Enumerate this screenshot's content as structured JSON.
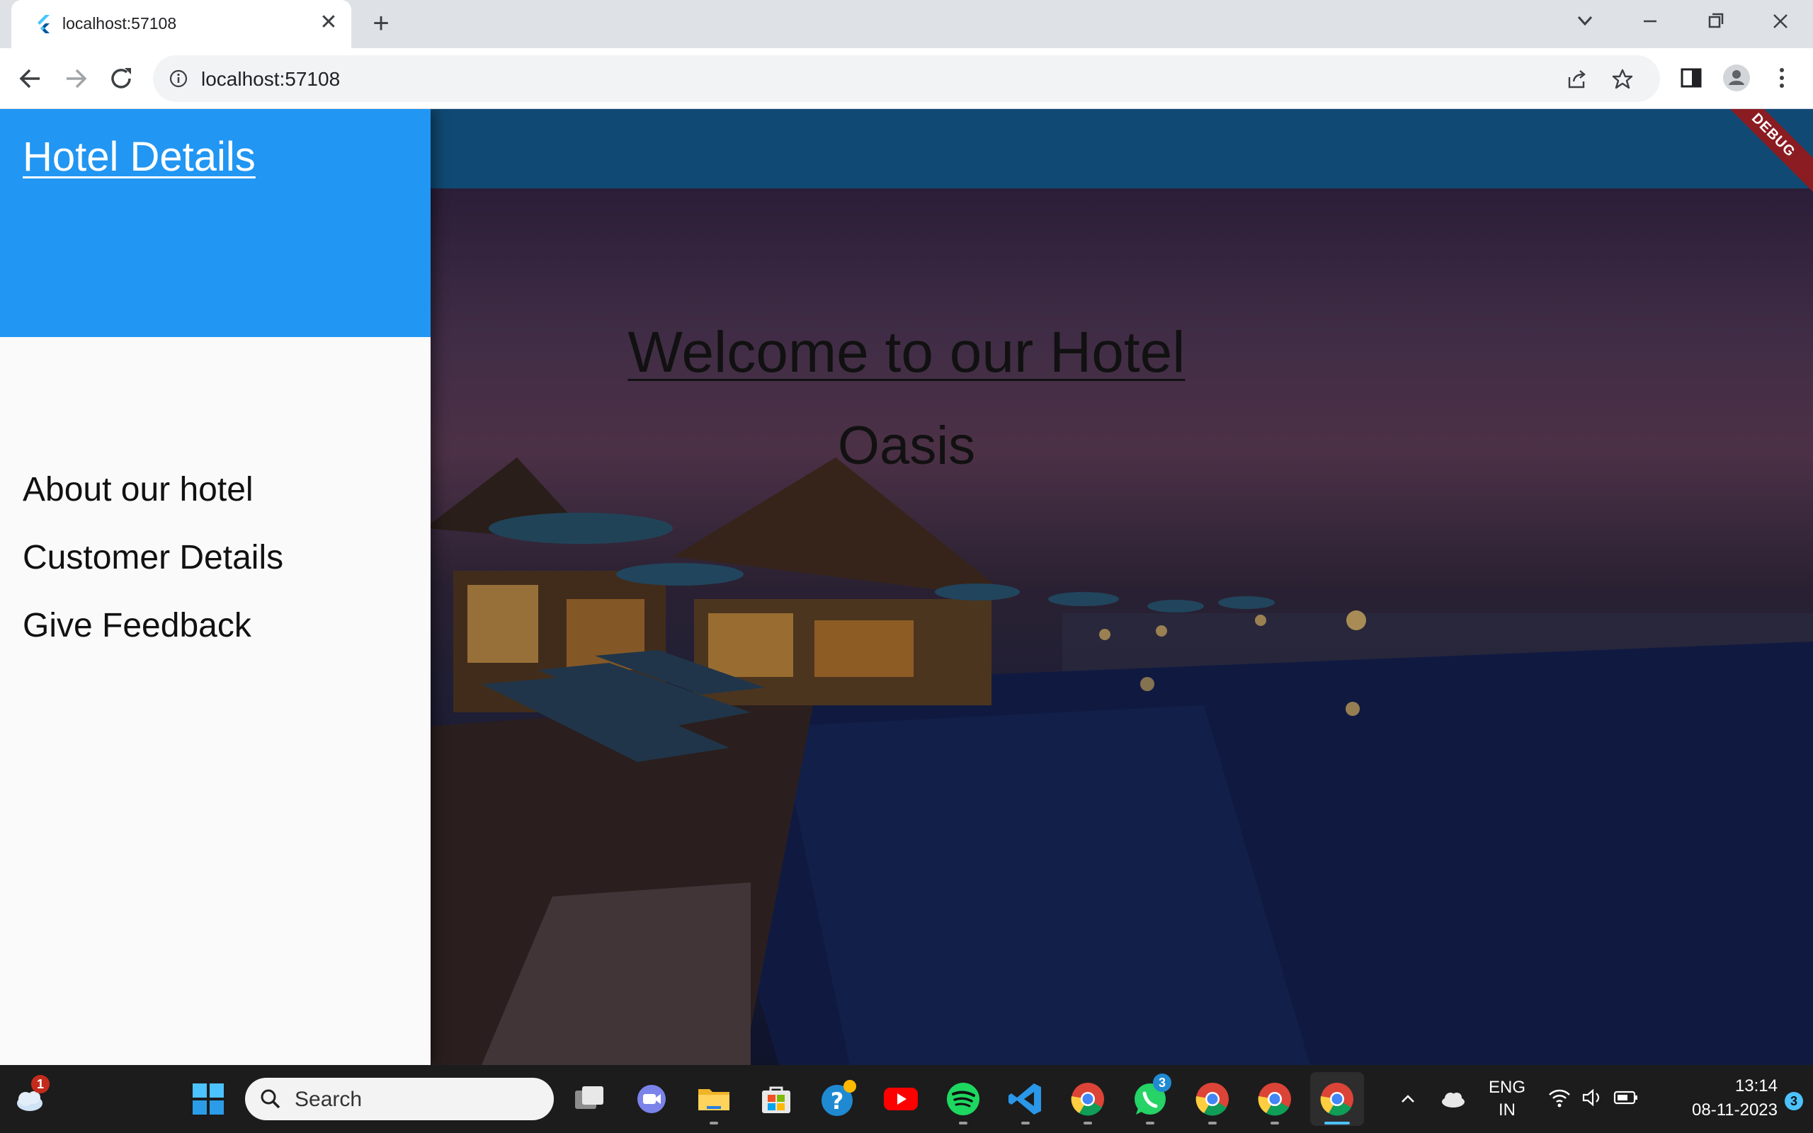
{
  "browser": {
    "tab_title": "localhost:57108",
    "url": "localhost:57108",
    "new_tab_symbol": "+",
    "close_tab_symbol": "✕",
    "window_controls": [
      "chevron-down-icon",
      "minimize-icon",
      "restore-icon",
      "close-icon"
    ]
  },
  "app": {
    "drawer": {
      "title": "Hotel Details",
      "items": [
        "About our hotel",
        "Customer Details",
        "Give Feedback"
      ]
    },
    "hero": {
      "heading": "Welcome to our Hotel",
      "subheading": "Oasis"
    },
    "debug_banner": "DEBUG",
    "colors": {
      "drawer_header": "#2196f3",
      "appbar": "#104a74"
    }
  },
  "taskbar": {
    "search_placeholder": "Search",
    "weather_badge": "1",
    "whatsapp_badge": "3",
    "language_line1": "ENG",
    "language_line2": "IN",
    "time": "13:14",
    "date": "08-11-2023",
    "notification_count": "3"
  }
}
